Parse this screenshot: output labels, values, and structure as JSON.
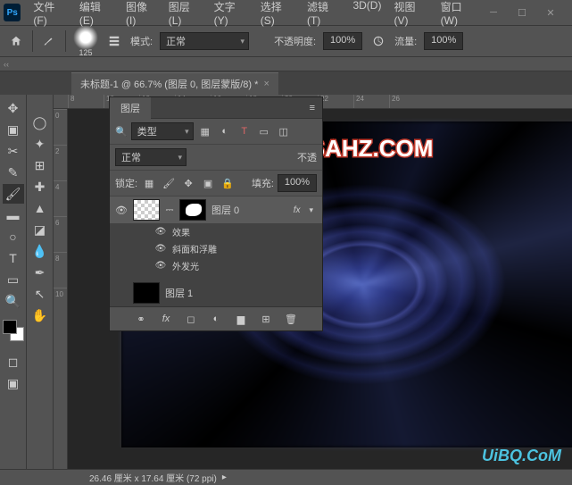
{
  "app": {
    "logo": "Ps"
  },
  "menu": [
    "文件(F)",
    "编辑(E)",
    "图像(I)",
    "图层(L)",
    "文字(Y)",
    "选择(S)",
    "滤镜(T)",
    "3D(D)",
    "视图(V)",
    "窗口(W)"
  ],
  "options": {
    "brush_size": "125",
    "mode_label": "模式:",
    "mode_value": "正常",
    "opacity_label": "不透明度:",
    "opacity_value": "100%",
    "flow_label": "流量:",
    "flow_value": "100%"
  },
  "tab": {
    "title": "未标题-1 @ 66.7% (图层 0, 图层蒙版/8) *"
  },
  "ruler_h": [
    "8",
    "10",
    "12",
    "14",
    "16",
    "18",
    "20",
    "22",
    "24",
    "26"
  ],
  "ruler_v": [
    "0",
    "2",
    "4",
    "6",
    "8",
    "10"
  ],
  "layers_panel": {
    "title": "图层",
    "type_label": "类型",
    "blend_mode": "正常",
    "opacity_label": "不透",
    "lock_label": "锁定:",
    "fill_label": "填充:",
    "fill_value": "100%",
    "layers": [
      {
        "name": "图层 0",
        "fx": "fx",
        "effects_label": "效果",
        "sub": [
          "斜面和浮雕",
          "外发光"
        ]
      },
      {
        "name": "图层 1"
      }
    ]
  },
  "status": "26.46 厘米 x 17.64 厘米 (72 ppi)",
  "watermark": "WWW.PSAHZ.COM",
  "uibq": "UiBQ.CoM"
}
